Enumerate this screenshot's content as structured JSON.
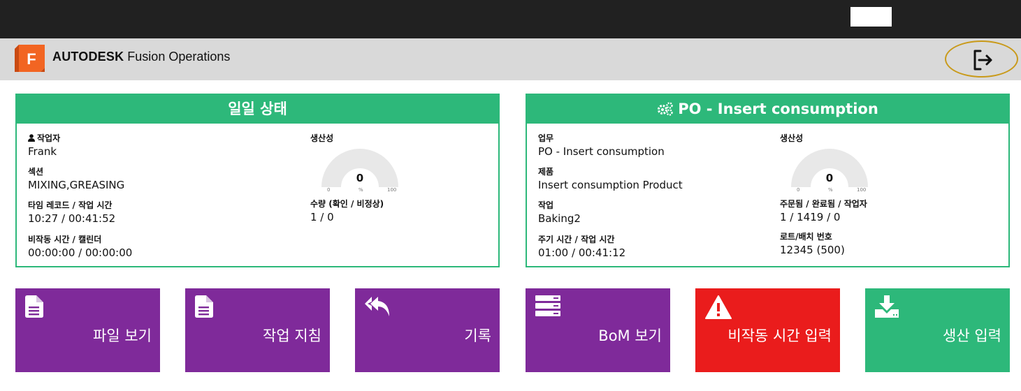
{
  "app": {
    "brand": "AUTODESK",
    "product": "Fusion Operations",
    "logo_letter": "F"
  },
  "left_panel": {
    "title": "일일 상태",
    "operator_label": "작업자",
    "operator_value": "Frank",
    "section_label": "섹션",
    "section_value": "MIXING,GREASING",
    "time_label": "타임 레코드 / 작업 시간",
    "time_value": "10:27 / 00:41:52",
    "downtime_label": "비작동 시간 / 캘린더",
    "downtime_value": "00:00:00 / 00:00:00",
    "productivity_label": "생산성",
    "gauge": {
      "value": "0",
      "min": "0",
      "mid": "%",
      "max": "100",
      "level": 0
    },
    "quantity_label": "수량 (확인 / 비정상)",
    "quantity_value": "1 / 0"
  },
  "right_panel": {
    "title": "PO - Insert consumption",
    "task_label": "업무",
    "task_value": "PO - Insert consumption",
    "product_label": "제품",
    "product_value": "Insert consumption Product",
    "operation_label": "작업",
    "operation_value": "Baking2",
    "cycle_label": "주기 시간 / 작업 시간",
    "cycle_value": "01:00 / 00:41:12",
    "productivity_label": "생산성",
    "gauge": {
      "value": "0",
      "min": "0",
      "mid": "%",
      "max": "100",
      "level": 0
    },
    "ordered_label": "주문됨 / 완료됨 / 작업자",
    "ordered_value": "1 / 1419 / 0",
    "lot_label": "로트/배치 번호",
    "lot_value": "12345 (500)"
  },
  "tiles": {
    "view_files": "파일 보기",
    "work_instructions": "작업 지침",
    "history": "기록",
    "bom": "BoM 보기",
    "downtime_entry": "비작동 시간 입력",
    "production_entry": "생산 입력"
  },
  "colors": {
    "accent_green": "#2db87a",
    "tile_purple": "#7f2a9a",
    "tile_red": "#ea1c1c",
    "logout_ring": "#c99a1a",
    "logo_orange": "#f26522"
  },
  "icons": {
    "logout": "logout-icon",
    "user": "user-icon",
    "gears": "gears-icon",
    "file": "file-icon",
    "reply_all": "reply-all-icon",
    "server": "server-icon",
    "warning": "warning-icon",
    "download": "download-icon"
  }
}
